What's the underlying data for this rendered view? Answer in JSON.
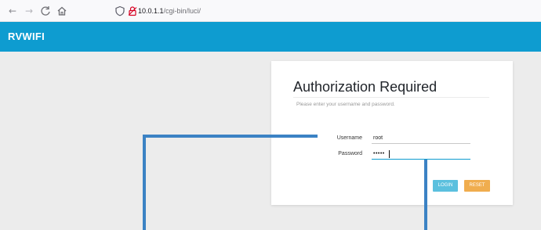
{
  "browser": {
    "nav_icons": [
      "back-arrow-icon",
      "forward-arrow-icon",
      "reload-icon",
      "home-icon"
    ],
    "back_glyph": "←",
    "forward_glyph": "→",
    "reload_glyph": "C",
    "home_glyph": "⌂",
    "url_host": "10.0.1.1",
    "url_path": "/cgi-bin/luci/"
  },
  "header": {
    "brand": "RVWIFI",
    "color": "#0e9cd0"
  },
  "login": {
    "title": "Authorization Required",
    "subtitle": "Please enter your username and password.",
    "username_label": "Username",
    "username_value": "root",
    "password_label": "Password",
    "password_mask": "•••••",
    "login_button": "LOGIN",
    "reset_button": "RESET"
  },
  "colors": {
    "login_button": "#5bc0de",
    "reset_button": "#f0ad4e",
    "annotation_line": "#3b82c4",
    "background": "#ececec"
  }
}
